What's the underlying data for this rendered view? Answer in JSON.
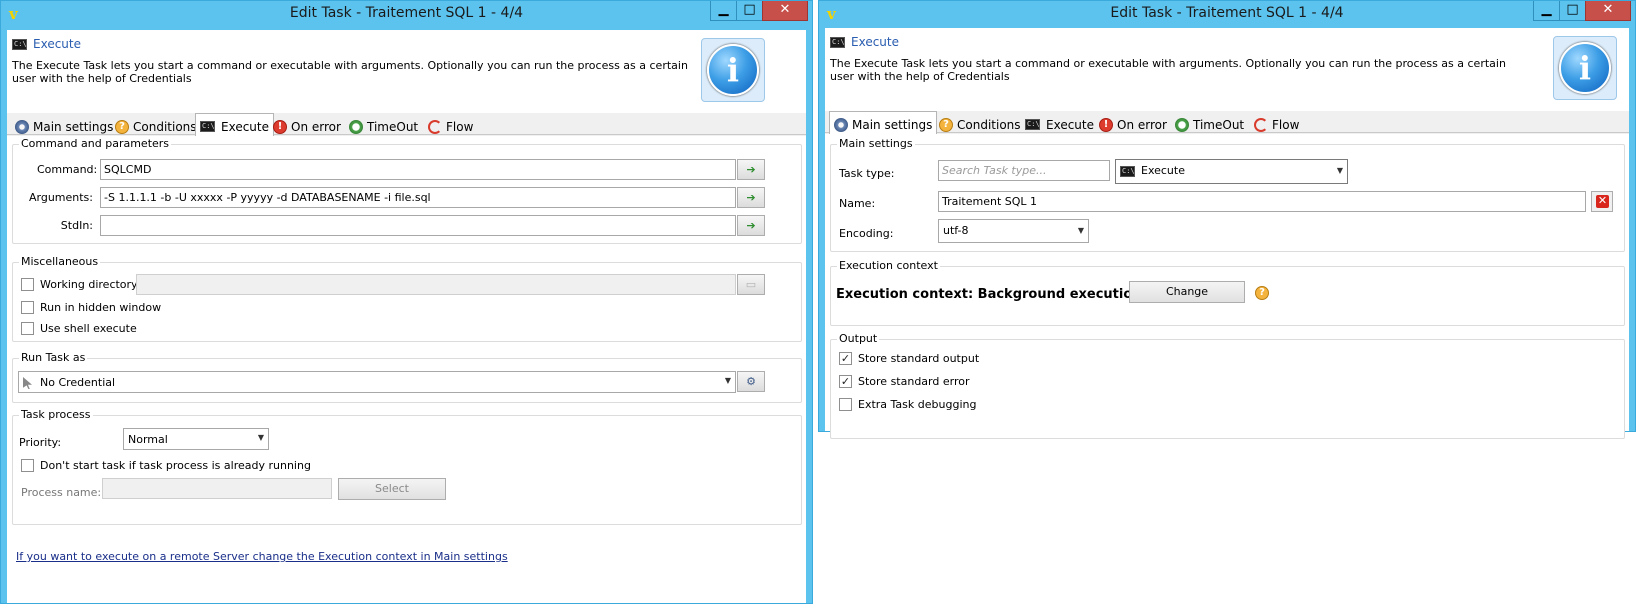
{
  "left_window": {
    "title": "Edit Task - Traitement SQL 1 - 4/4",
    "controls": {
      "minimize": "▁",
      "maximize": "□",
      "close": "✕"
    },
    "header": {
      "title": "Execute",
      "description": "The Execute Task lets you start a command or executable with arguments. Optionally you can run the process as a certain user with the help of Credentials"
    },
    "tabs": [
      "Main settings",
      "Conditions",
      "Execute",
      "On error",
      "TimeOut",
      "Flow"
    ],
    "active_tab": "Execute",
    "command_group": {
      "title": "Command and parameters",
      "command_label": "Command:",
      "command_value": "SQLCMD",
      "arguments_label": "Arguments:",
      "arguments_value": "-S 1.1.1.1 -b -U xxxxx -P yyyyy -d DATABASENAME -i file.sql",
      "stdin_label": "StdIn:",
      "stdin_value": ""
    },
    "misc_group": {
      "title": "Miscellaneous",
      "working_directory_label": "Working directory:",
      "working_directory_checked": false,
      "hidden_window_label": "Run in hidden window",
      "hidden_window_checked": false,
      "shell_execute_label": "Use shell execute",
      "shell_execute_checked": false
    },
    "run_as_group": {
      "title": "Run Task as",
      "credential_value": "No Credential"
    },
    "process_group": {
      "title": "Task process",
      "priority_label": "Priority:",
      "priority_value": "Normal",
      "dont_start_label": "Don't start task if task process is already running",
      "dont_start_checked": false,
      "process_name_label": "Process name:",
      "process_name_value": "",
      "select_label": "Select"
    },
    "footer_link": "If you want to execute on a remote Server change the Execution context in Main settings"
  },
  "right_window": {
    "title": "Edit Task - Traitement SQL 1 - 4/4",
    "controls": {
      "minimize": "▁",
      "maximize": "□",
      "close": "✕"
    },
    "header": {
      "title": "Execute",
      "description": "The Execute Task lets you start a command or executable with arguments. Optionally you can run the process as a certain user with the help of Credentials"
    },
    "tabs": [
      "Main settings",
      "Conditions",
      "Execute",
      "On error",
      "TimeOut",
      "Flow"
    ],
    "active_tab": "Main settings",
    "main_group": {
      "title": "Main settings",
      "task_type_label": "Task type:",
      "task_type_placeholder": "Search Task type...",
      "task_type_value": "Execute",
      "name_label": "Name:",
      "name_value": "Traitement SQL 1",
      "encoding_label": "Encoding:",
      "encoding_value": "utf-8"
    },
    "context_group": {
      "title": "Execution context",
      "context_text": "Execution context: Background execution",
      "change_label": "Change"
    },
    "output_group": {
      "title": "Output",
      "store_output_label": "Store standard output",
      "store_output_checked": true,
      "store_error_label": "Store standard error",
      "store_error_checked": true,
      "extra_debug_label": "Extra Task debugging",
      "extra_debug_checked": false
    }
  },
  "colors": {
    "frame": "#5cc3ee",
    "close_button": "#c7504b",
    "header_title": "#2a5db0",
    "link": "#1a2f8a"
  }
}
